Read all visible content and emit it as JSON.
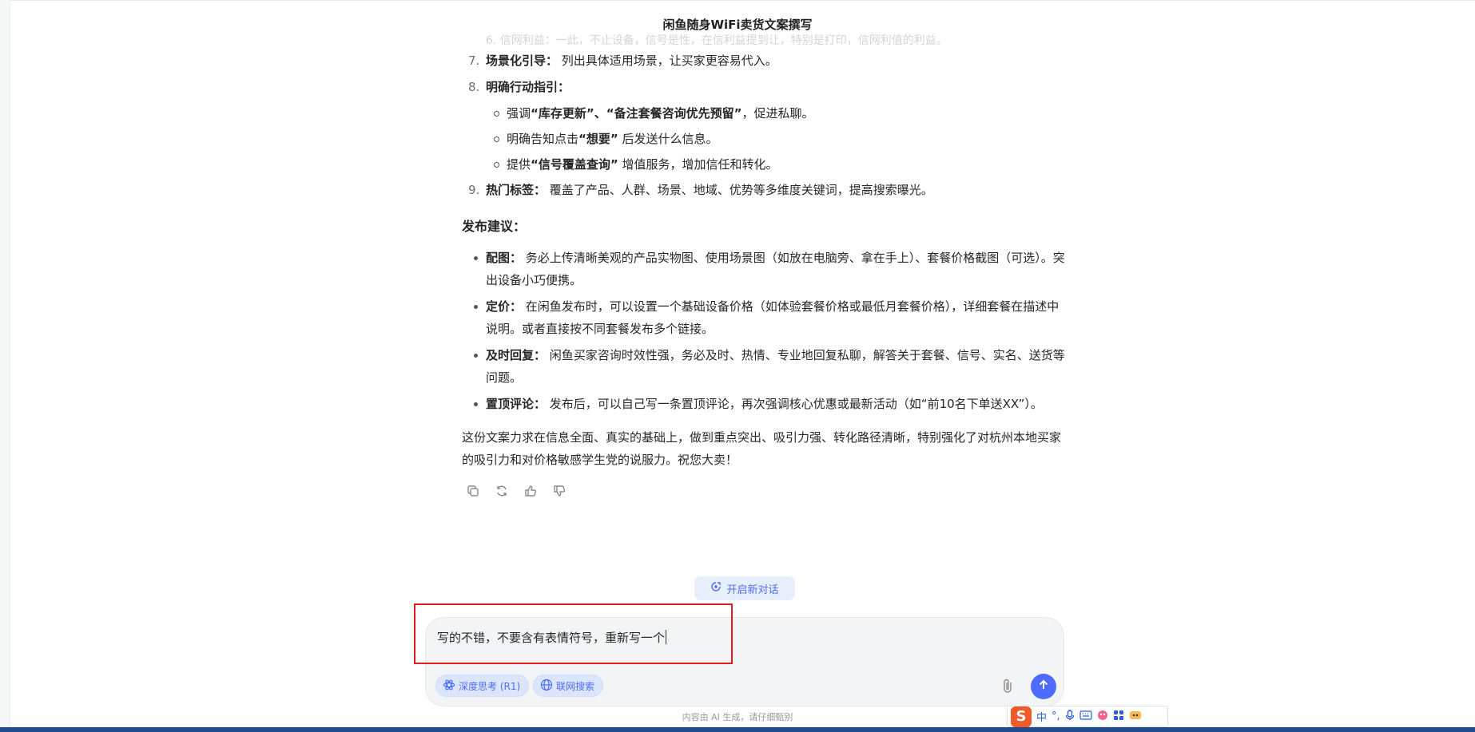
{
  "header": {
    "title": "闲鱼随身WiFi卖货文案撰写"
  },
  "message": {
    "faded_line": "6. 信网利益：一此，不止设备，信号是性，在信利益提到让，特别是打印，信网利值的利益。",
    "numbered_items": [
      {
        "num": "7.",
        "title": "场景化引导：",
        "text": "列出具体适用场景，让买家更容易代入。"
      },
      {
        "num": "8.",
        "title": "明确行动指引：",
        "text": ""
      }
    ],
    "sub_items": [
      {
        "prefix": "强调",
        "bold": "“库存更新”、“备注套餐咨询优先预留”",
        "suffix": "，促进私聊。"
      },
      {
        "prefix": "明确告知点击",
        "bold": "“想要”",
        "suffix": " 后发送什么信息。"
      },
      {
        "prefix": "提供",
        "bold": "“信号覆盖查询”",
        "suffix": " 增值服务，增加信任和转化。"
      }
    ],
    "item9": {
      "num": "9.",
      "title": "热门标签：",
      "text": "覆盖了产品、人群、场景、地域、优势等多维度关键词，提高搜索曝光。"
    },
    "publish_heading": "发布建议：",
    "publish_items": [
      {
        "title": "配图：",
        "text": "务必上传清晰美观的产品实物图、使用场景图（如放在电脑旁、拿在手上）、套餐价格截图（可选）。突出设备小巧便携。"
      },
      {
        "title": "定价：",
        "text": "在闲鱼发布时，可以设置一个基础设备价格（如体验套餐价格或最低月套餐价格），详细套餐在描述中说明。或者直接按不同套餐发布多个链接。"
      },
      {
        "title": "及时回复：",
        "text": "闲鱼买家咨询时效性强，务必及时、热情、专业地回复私聊，解答关于套餐、信号、实名、送货等问题。"
      },
      {
        "title": "置顶评论：",
        "text": "发布后，可以自己写一条置顶评论，再次强调核心优惠或最新活动（如“前10名下单送XX”）。"
      }
    ],
    "conclusion": "这份文案力求在信息全面、真实的基础上，做到重点突出、吸引力强、转化路径清晰，特别强化了对杭州本地买家的吸引力和对价格敏感学生党的说服力。祝您大卖！",
    "actions": [
      "copy-icon",
      "regenerate-icon",
      "thumbs-up-icon",
      "thumbs-down-icon"
    ]
  },
  "new_chat": {
    "label": "开启新对话"
  },
  "composer": {
    "value": "写的不错，不要含有表情符号，重新写一个",
    "deep_think_label": "深度思考 (R1)",
    "web_search_label": "联网搜索"
  },
  "disclaimer": "内容由 AI 生成，请仔细甄别",
  "ime": {
    "lang": "中",
    "punct": "°,"
  },
  "colors": {
    "accent": "#4d6bfe",
    "highlight_border": "#e02020",
    "taskbar": "#1f4b8e"
  }
}
